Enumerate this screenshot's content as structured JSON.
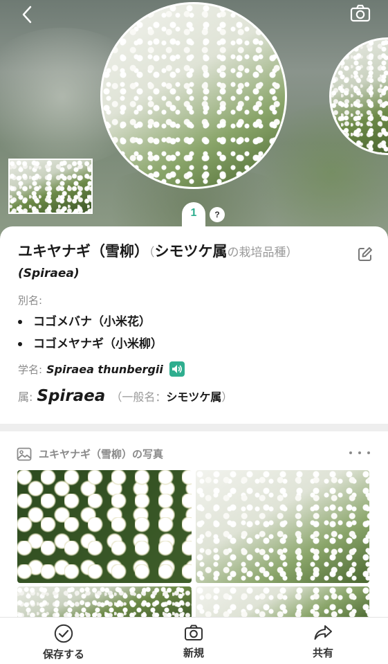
{
  "hero": {
    "current_page": "1",
    "help_label": "?"
  },
  "plant": {
    "name": "ユキヤナギ（雪柳）",
    "open_paren": "（",
    "group_name": "シモツケ属",
    "cultivar_text": "の栽培品種）",
    "group_scientific": "(Spiraea)",
    "aliases_label": "別名:",
    "aliases": [
      "コゴメバナ（小米花）",
      "コゴメヤナギ（小米柳）"
    ],
    "scientific_label": "学名:",
    "scientific_name": "Spiraea thunbergii",
    "genus_label": "属:",
    "genus": "Spiraea",
    "genus_common_prefix": "（一般名：",
    "genus_common": "シモツケ属",
    "genus_common_suffix": "）"
  },
  "photos": {
    "title": "ユキヤナギ（雪柳）の写真"
  },
  "bottom_bar": {
    "save_label": "保存する",
    "new_label": "新規",
    "share_label": "共有"
  },
  "colors": {
    "accent": "#2fae8f",
    "text": "#1a1a1a",
    "muted": "#8a8a8a"
  }
}
